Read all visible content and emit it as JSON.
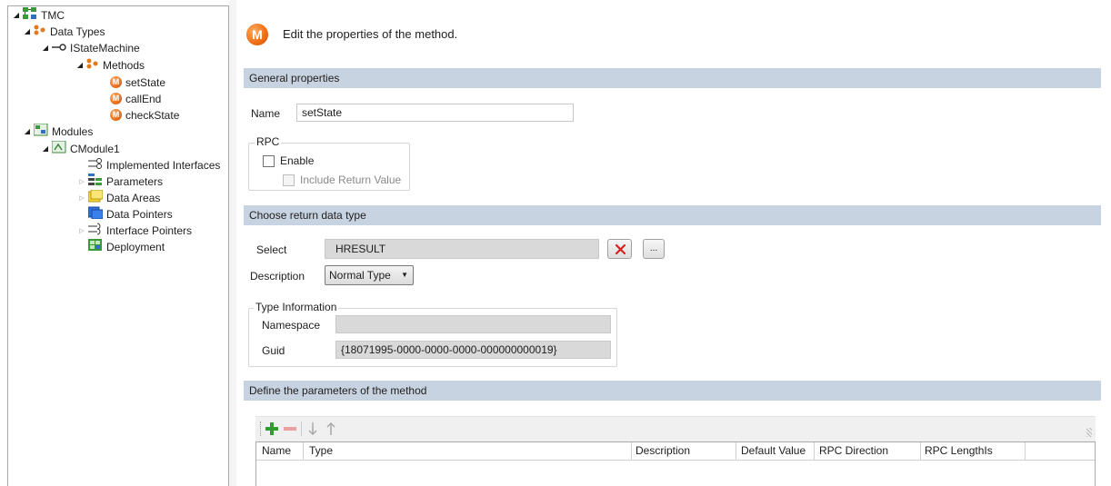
{
  "tree": {
    "root": "TMC",
    "data_types": "Data Types",
    "istatemachine": "IStateMachine",
    "methods": "Methods",
    "method_items": [
      "setState",
      "callEnd",
      "checkState"
    ],
    "modules": "Modules",
    "cmodule1": "CModule1",
    "module_children": [
      "Implemented Interfaces",
      "Parameters",
      "Data Areas",
      "Data Pointers",
      "Interface Pointers",
      "Deployment"
    ],
    "method_icon_letter": "M"
  },
  "header": {
    "icon_letter": "M",
    "title": "Edit the properties of the method."
  },
  "general": {
    "section_title": "General properties",
    "name_label": "Name",
    "name_value": "setState",
    "rpc_group": "RPC",
    "enable_label": "Enable",
    "enable_checked": false,
    "include_return_label": "Include Return Value",
    "include_return_checked": false
  },
  "return_type": {
    "section_title": "Choose return data type",
    "select_label": "Select",
    "select_value": "HRESULT",
    "browse_label": "...",
    "description_label": "Description",
    "description_value": "Normal Type",
    "type_info_group": "Type Information",
    "namespace_label": "Namespace",
    "namespace_value": "",
    "guid_label": "Guid",
    "guid_value": "{18071995-0000-0000-0000-000000000019}"
  },
  "parameters": {
    "section_title": "Define the parameters of the method",
    "columns": [
      "Name",
      "Type",
      "Description",
      "Default Value",
      "RPC Direction",
      "RPC LengthIs"
    ]
  },
  "colors": {
    "section_bg": "#c8d3e1",
    "method_icon": "#ef6c12",
    "add_icon": "#2e9e2e",
    "remove_icon": "#e07a7a",
    "clear_icon": "#d92020"
  },
  "icons": [
    "expand-triangle",
    "tmc-icon",
    "data-types-icon",
    "interface-icon",
    "method-icon",
    "modules-icon",
    "module-icon",
    "implemented-interfaces-icon",
    "parameters-icon",
    "data-areas-icon",
    "data-pointers-icon",
    "interface-pointers-icon",
    "deployment-icon",
    "clear-icon",
    "add-icon",
    "remove-icon",
    "move-down-icon",
    "move-up-icon",
    "dropdown-arrow-icon"
  ]
}
